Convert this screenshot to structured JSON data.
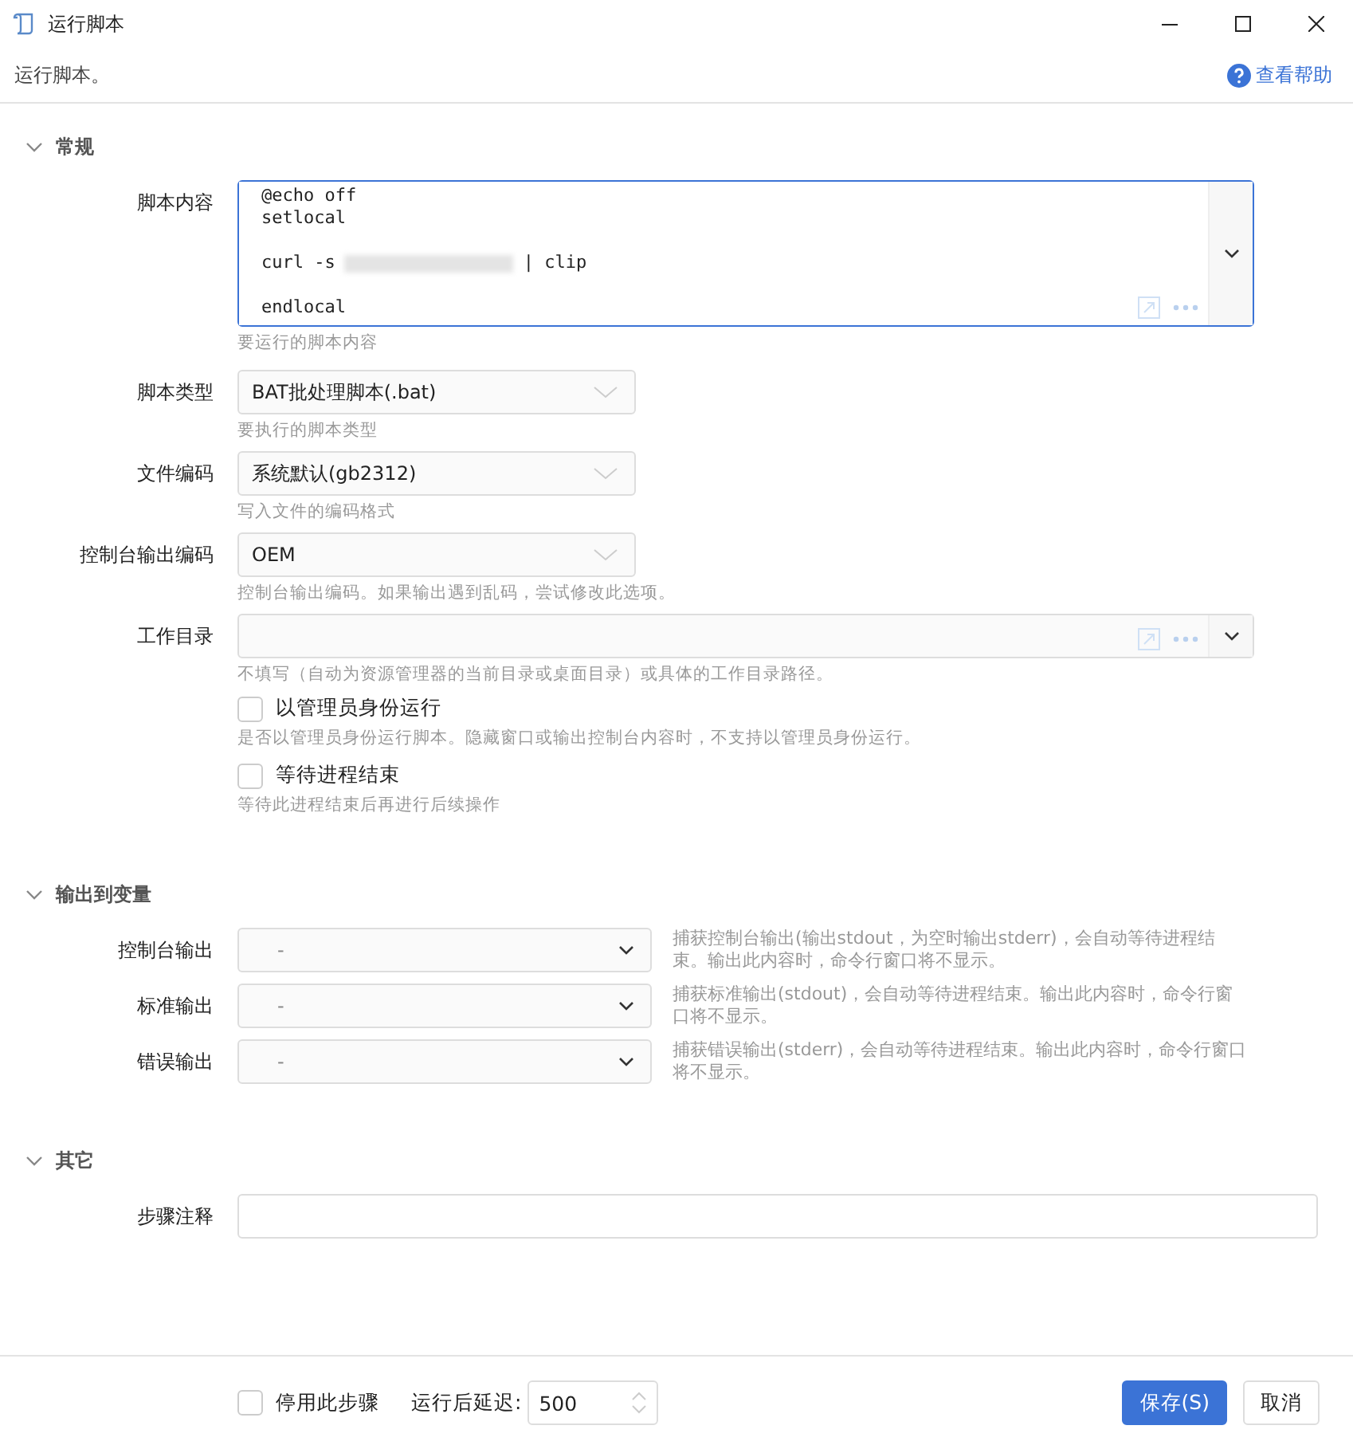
{
  "window": {
    "title": "运行脚本"
  },
  "header": {
    "description": "运行脚本。",
    "help_link": "查看帮助"
  },
  "sections": [
    {
      "title": "常规",
      "expanded": true,
      "fields": [
        {
          "kind": "code",
          "label": "脚本内容",
          "lines": [
            {
              "kind": "code",
              "segments": [
                "@echo off"
              ]
            },
            {
              "kind": "code",
              "segments": [
                "setlocal"
              ]
            },
            {
              "kind": "blank"
            },
            {
              "kind": "code",
              "segments": [
                "curl -s",
                "| clip"
              ]
            },
            {
              "kind": "blank"
            },
            {
              "kind": "code",
              "segments": [
                "endlocal"
              ]
            }
          ],
          "hint": "要运行的脚本内容"
        },
        {
          "kind": "select",
          "label": "脚本类型",
          "value": "BAT批处理脚本(.bat)",
          "hint": "要执行的脚本类型"
        },
        {
          "kind": "select",
          "label": "文件编码",
          "value": "系统默认(gb2312)",
          "hint": "写入文件的编码格式"
        },
        {
          "kind": "select",
          "label": "控制台输出编码",
          "value": "OEM",
          "hint": "控制台输出编码。如果输出遇到乱码，尝试修改此选项。"
        },
        {
          "kind": "path",
          "label": "工作目录",
          "hint": "不填写（自动为资源管理器的当前目录或桌面目录）或具体的工作目录路径。"
        },
        {
          "kind": "checkbox",
          "text": "以管理员身份运行",
          "checked": false,
          "hint": "是否以管理员身份运行脚本。隐藏窗口或输出控制台内容时，不支持以管理员身份运行。"
        },
        {
          "kind": "checkbox",
          "text": "等待进程结束",
          "checked": false,
          "hint": "等待此进程结束后再进行后续操作"
        }
      ]
    },
    {
      "title": "输出到变量",
      "expanded": true,
      "fields": [
        {
          "kind": "output",
          "label": "控制台输出",
          "placeholder": "-",
          "hint": "捕获控制台输出(输出stdout，为空时输出stderr)，会自动等待进程结束。输出此内容时，命令行窗口将不显示。"
        },
        {
          "kind": "output",
          "label": "标准输出",
          "placeholder": "-",
          "hint": "捕获标准输出(stdout)，会自动等待进程结束。输出此内容时，命令行窗口将不显示。"
        },
        {
          "kind": "output",
          "label": "错误输出",
          "placeholder": "-",
          "hint": "捕获错误输出(stderr)，会自动等待进程结束。输出此内容时，命令行窗口将不显示。"
        }
      ]
    },
    {
      "title": "其它",
      "expanded": true,
      "fields": [
        {
          "kind": "text",
          "label": "步骤注释"
        }
      ]
    }
  ],
  "footer": {
    "disable_step": {
      "label": "停用此步骤",
      "checked": false
    },
    "delay_label": "运行后延迟:",
    "delay_value": "500",
    "buttons": [
      {
        "label": "保存(S)",
        "kind": "primary"
      },
      {
        "label": "取消",
        "kind": "secondary"
      }
    ]
  }
}
